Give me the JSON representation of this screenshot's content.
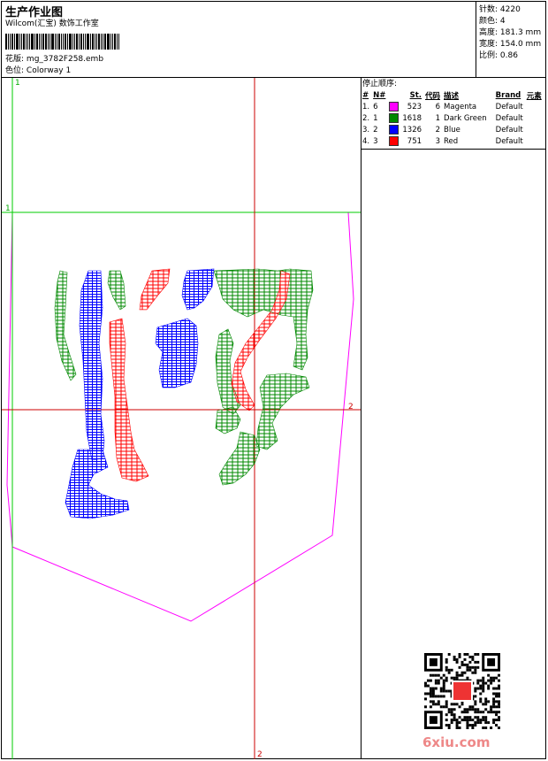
{
  "header": {
    "title": "生产作业图",
    "company": "Wilcom(汇宝) 数饰工作室",
    "design_label": "花版:",
    "design_value": "mg_3782F258.emb",
    "colorway_label": "色位:",
    "colorway_value": "Colorway 1"
  },
  "stats": {
    "stitches_label": "针数:",
    "stitches_value": "4220",
    "colors_label": "颜色:",
    "colors_value": "4",
    "height_label": "高度:",
    "height_value": "181.3 mm",
    "width_label": "宽度:",
    "width_value": "154.0 mm",
    "scale_label": "比例:",
    "scale_value": "0.86"
  },
  "stop_sequence": {
    "title": "停止顺序:",
    "columns": [
      "#",
      "N#",
      "",
      "St.",
      "代码",
      "描述",
      "Brand",
      "元素"
    ],
    "rows": [
      {
        "idx": "1.",
        "n": "6",
        "color": "#ff00ff",
        "st": "523",
        "code": "6",
        "desc": "Magenta",
        "brand": "Default"
      },
      {
        "idx": "2.",
        "n": "1",
        "color": "#008800",
        "st": "1618",
        "code": "1",
        "desc": "Dark Green",
        "brand": "Default"
      },
      {
        "idx": "3.",
        "n": "2",
        "color": "#0000ff",
        "st": "1326",
        "code": "2",
        "desc": "Blue",
        "brand": "Default"
      },
      {
        "idx": "4.",
        "n": "3",
        "color": "#ff0000",
        "st": "751",
        "code": "3",
        "desc": "Red",
        "brand": "Default"
      }
    ]
  },
  "canvas": {
    "axis_labels": {
      "green_v": "1",
      "green_h": "1",
      "red_h": "2",
      "red_v": "2"
    }
  },
  "watermark": {
    "text": "6xiu.com"
  },
  "colors": {
    "magenta": "#ff00ff",
    "green": "#008800",
    "blue": "#0000ff",
    "red": "#ff0000",
    "guide_green": "#00cc00",
    "guide_red": "#cc0000"
  }
}
